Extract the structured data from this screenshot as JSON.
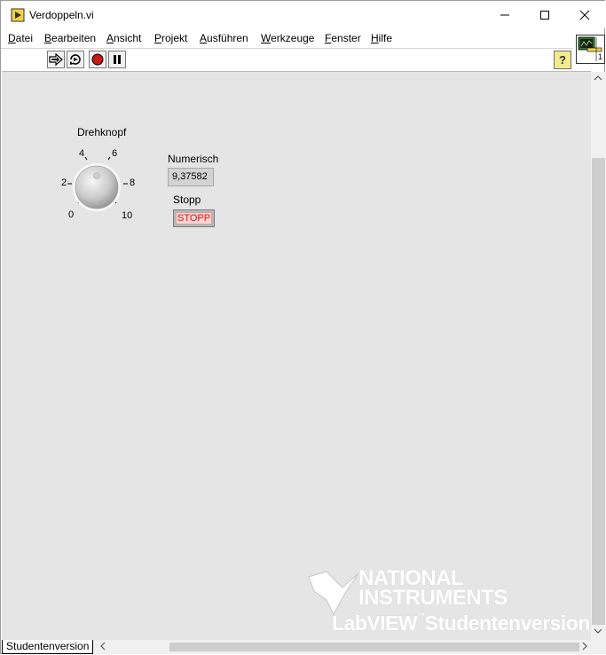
{
  "window": {
    "title": "Verdoppeln.vi",
    "minimize_glyph": "─",
    "maximize_glyph": "☐",
    "close_glyph": "✕"
  },
  "menu": {
    "items": [
      {
        "access": "D",
        "rest": "atei"
      },
      {
        "access": "B",
        "rest": "earbeiten"
      },
      {
        "access": "A",
        "rest": "nsicht"
      },
      {
        "access": "P",
        "rest": "rojekt"
      },
      {
        "access": "A",
        "rest": "usführen"
      },
      {
        "access": "W",
        "rest": "erkzeuge"
      },
      {
        "access": "F",
        "rest": "enster"
      },
      {
        "access": "H",
        "rest": "ilfe"
      }
    ]
  },
  "toolbar": {
    "icons": [
      "run-arrow-icon",
      "run-continuously-icon",
      "abort-icon",
      "pause-icon"
    ],
    "help_glyph": "?"
  },
  "connector_pane": {
    "terminal_label": "1"
  },
  "front_panel": {
    "knob": {
      "label": "Drehknopf",
      "ticks": [
        "0",
        "2",
        "4",
        "6",
        "8",
        "10"
      ]
    },
    "numeric": {
      "label": "Numerisch",
      "value": "9,37582"
    },
    "stop": {
      "label": "Stopp",
      "button_text": "STOPP"
    }
  },
  "watermark": {
    "line1": "NATIONAL",
    "line2": "INSTRUMENTS",
    "line3_brand": "LabVIEW",
    "line3_tm": "™",
    "line3_rest": "Studentenversion"
  },
  "statusbar": {
    "tab_label": "Studentenversion"
  },
  "colors": {
    "panel_bg": "#e5e5e5",
    "stop_text": "#e01010",
    "help_bg": "#f2eb8d"
  }
}
